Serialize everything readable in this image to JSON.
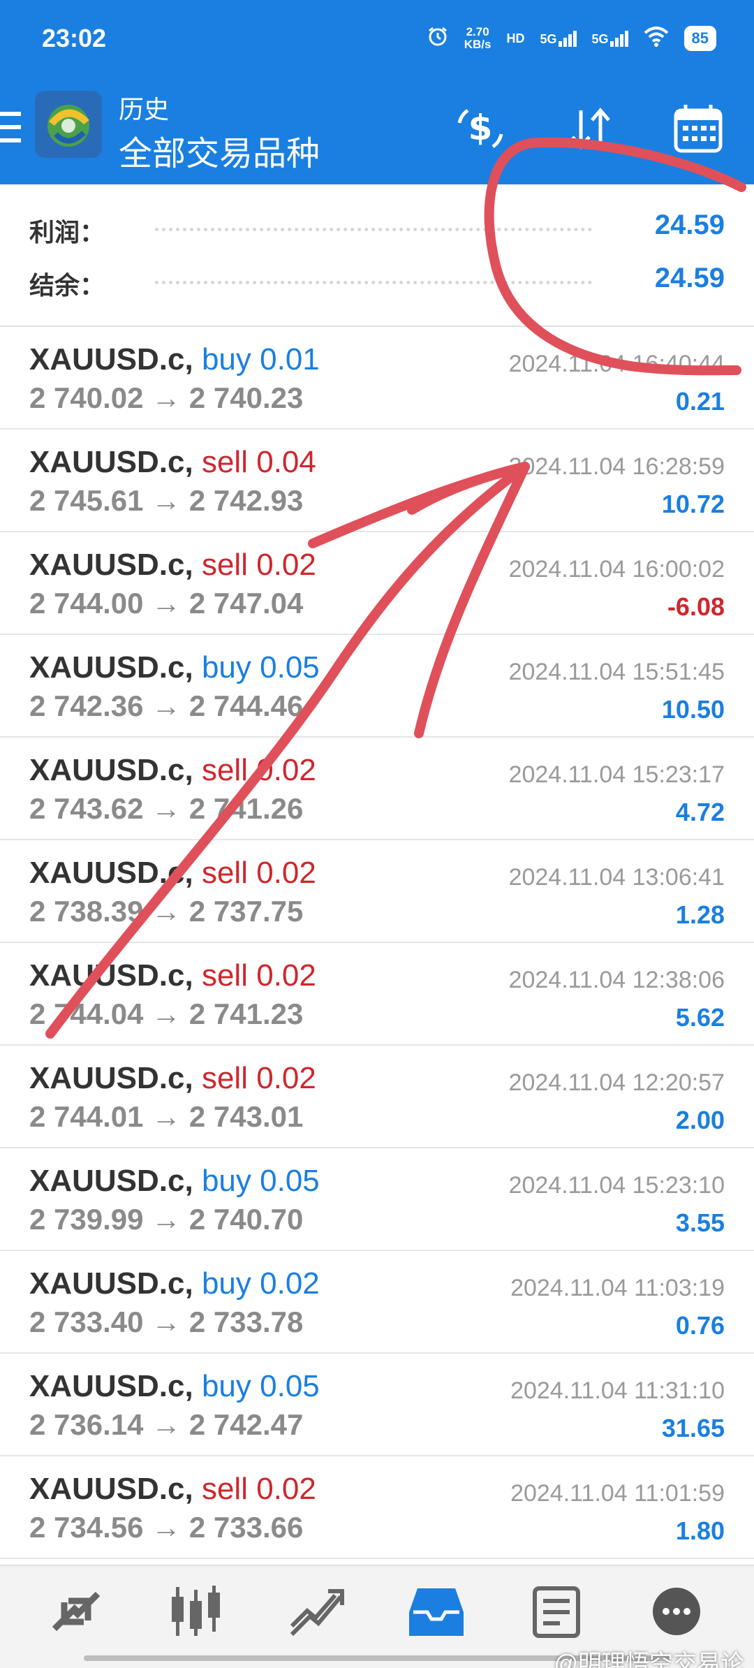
{
  "status_bar": {
    "time": "23:02",
    "net_speed_value": "2.70",
    "net_speed_unit": "KB/s",
    "hd": "HD",
    "sim1": "5G",
    "sim2": "5G",
    "battery": "85"
  },
  "toolbar": {
    "title": "历史",
    "subtitle": "全部交易品种",
    "icons": [
      "menu-icon",
      "metatrader-logo",
      "dollar-refresh-icon",
      "sort-icon",
      "calendar-icon"
    ]
  },
  "summary": {
    "profit_label": "利润：",
    "profit_value": "24.59",
    "balance_label": "结余：",
    "balance_value": "24.59"
  },
  "deals": [
    {
      "symbol": "XAUUSD.c,",
      "type": "buy",
      "volume": "0.01",
      "open": "2 740.02",
      "close": "2 740.23",
      "time": "2024.11.04 16:40:44",
      "profit": "0.21"
    },
    {
      "symbol": "XAUUSD.c,",
      "type": "sell",
      "volume": "0.04",
      "open": "2 745.61",
      "close": "2 742.93",
      "time": "2024.11.04 16:28:59",
      "profit": "10.72"
    },
    {
      "symbol": "XAUUSD.c,",
      "type": "sell",
      "volume": "0.02",
      "open": "2 744.00",
      "close": "2 747.04",
      "time": "2024.11.04 16:00:02",
      "profit": "-6.08"
    },
    {
      "symbol": "XAUUSD.c,",
      "type": "buy",
      "volume": "0.05",
      "open": "2 742.36",
      "close": "2 744.46",
      "time": "2024.11.04 15:51:45",
      "profit": "10.50"
    },
    {
      "symbol": "XAUUSD.c,",
      "type": "sell",
      "volume": "0.02",
      "open": "2 743.62",
      "close": "2 741.26",
      "time": "2024.11.04 15:23:17",
      "profit": "4.72"
    },
    {
      "symbol": "XAUUSD.c,",
      "type": "sell",
      "volume": "0.02",
      "open": "2 738.39",
      "close": "2 737.75",
      "time": "2024.11.04 13:06:41",
      "profit": "1.28"
    },
    {
      "symbol": "XAUUSD.c,",
      "type": "sell",
      "volume": "0.02",
      "open": "2 744.04",
      "close": "2 741.23",
      "time": "2024.11.04 12:38:06",
      "profit": "5.62"
    },
    {
      "symbol": "XAUUSD.c,",
      "type": "sell",
      "volume": "0.02",
      "open": "2 744.01",
      "close": "2 743.01",
      "time": "2024.11.04 12:20:57",
      "profit": "2.00"
    },
    {
      "symbol": "XAUUSD.c,",
      "type": "buy",
      "volume": "0.05",
      "open": "2 739.99",
      "close": "2 740.70",
      "time": "2024.11.04 15:23:10",
      "profit": "3.55"
    },
    {
      "symbol": "XAUUSD.c,",
      "type": "buy",
      "volume": "0.02",
      "open": "2 733.40",
      "close": "2 733.78",
      "time": "2024.11.04 11:03:19",
      "profit": "0.76"
    },
    {
      "symbol": "XAUUSD.c,",
      "type": "buy",
      "volume": "0.05",
      "open": "2 736.14",
      "close": "2 742.47",
      "time": "2024.11.04 11:31:10",
      "profit": "31.65"
    },
    {
      "symbol": "XAUUSD.c,",
      "type": "sell",
      "volume": "0.02",
      "open": "2 734.56",
      "close": "2 733.66",
      "time": "2024.11.04 11:01:59",
      "profit": "1.80"
    }
  ],
  "bottom_nav": {
    "icons": [
      "quotes-icon",
      "chart-icon",
      "trade-icon",
      "history-icon",
      "news-icon",
      "chat-icon"
    ]
  },
  "watermark": "@明理悟空交易论",
  "colors": {
    "brand": "#1a7fe0",
    "buy": "#1a7fe0",
    "sell": "#d0262d",
    "annotation": "#e0505a"
  }
}
